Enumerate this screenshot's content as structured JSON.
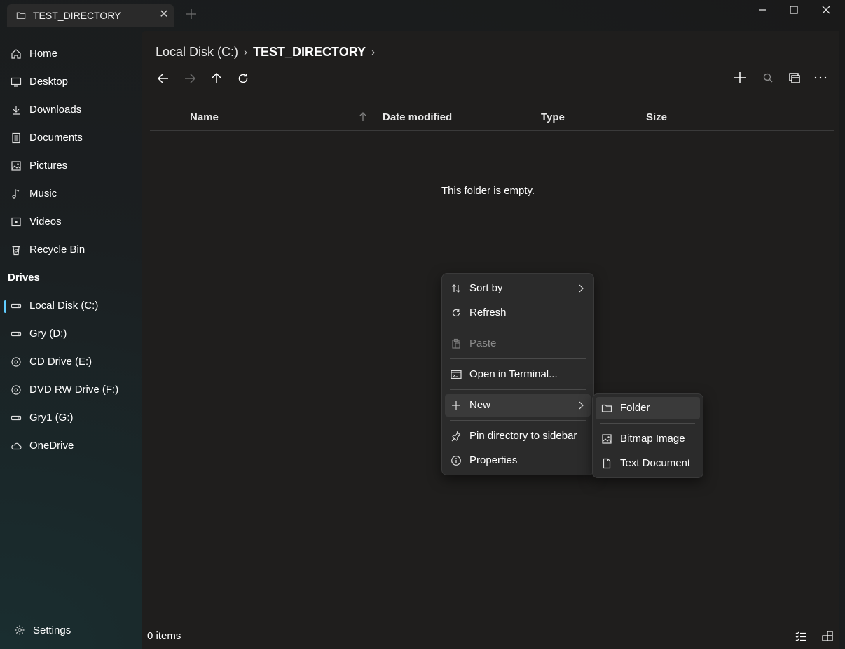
{
  "tab": {
    "title": "TEST_DIRECTORY"
  },
  "sidebar": {
    "items": [
      {
        "label": "Home",
        "icon": "home-icon"
      },
      {
        "label": "Desktop",
        "icon": "desktop-icon"
      },
      {
        "label": "Downloads",
        "icon": "download-icon"
      },
      {
        "label": "Documents",
        "icon": "document-icon"
      },
      {
        "label": "Pictures",
        "icon": "picture-icon"
      },
      {
        "label": "Music",
        "icon": "music-icon"
      },
      {
        "label": "Videos",
        "icon": "video-icon"
      },
      {
        "label": "Recycle Bin",
        "icon": "recycle-bin-icon"
      }
    ],
    "drives_header": "Drives",
    "drives": [
      {
        "label": "Local Disk (C:)",
        "icon": "drive-icon"
      },
      {
        "label": "Gry (D:)",
        "icon": "drive-icon"
      },
      {
        "label": "CD Drive (E:)",
        "icon": "disc-icon"
      },
      {
        "label": "DVD RW Drive (F:)",
        "icon": "disc-icon"
      },
      {
        "label": "Gry1 (G:)",
        "icon": "drive-icon"
      },
      {
        "label": "OneDrive",
        "icon": "cloud-icon"
      }
    ],
    "settings_label": "Settings"
  },
  "breadcrumb": {
    "segments": [
      "Local Disk (C:)",
      "TEST_DIRECTORY"
    ]
  },
  "columns": {
    "name": "Name",
    "date_modified": "Date modified",
    "type": "Type",
    "size": "Size"
  },
  "empty_message": "This folder is empty.",
  "status": {
    "item_count": "0 items"
  },
  "context_menu": {
    "sort_by": "Sort by",
    "refresh": "Refresh",
    "paste": "Paste",
    "open_terminal": "Open in Terminal...",
    "new": "New",
    "pin": "Pin directory to sidebar",
    "properties": "Properties"
  },
  "submenu": {
    "folder": "Folder",
    "bitmap": "Bitmap Image",
    "text_document": "Text Document"
  },
  "colors": {
    "accent": "#60cdff",
    "background": "#1f1e1d",
    "menu": "#2b2b2b"
  }
}
